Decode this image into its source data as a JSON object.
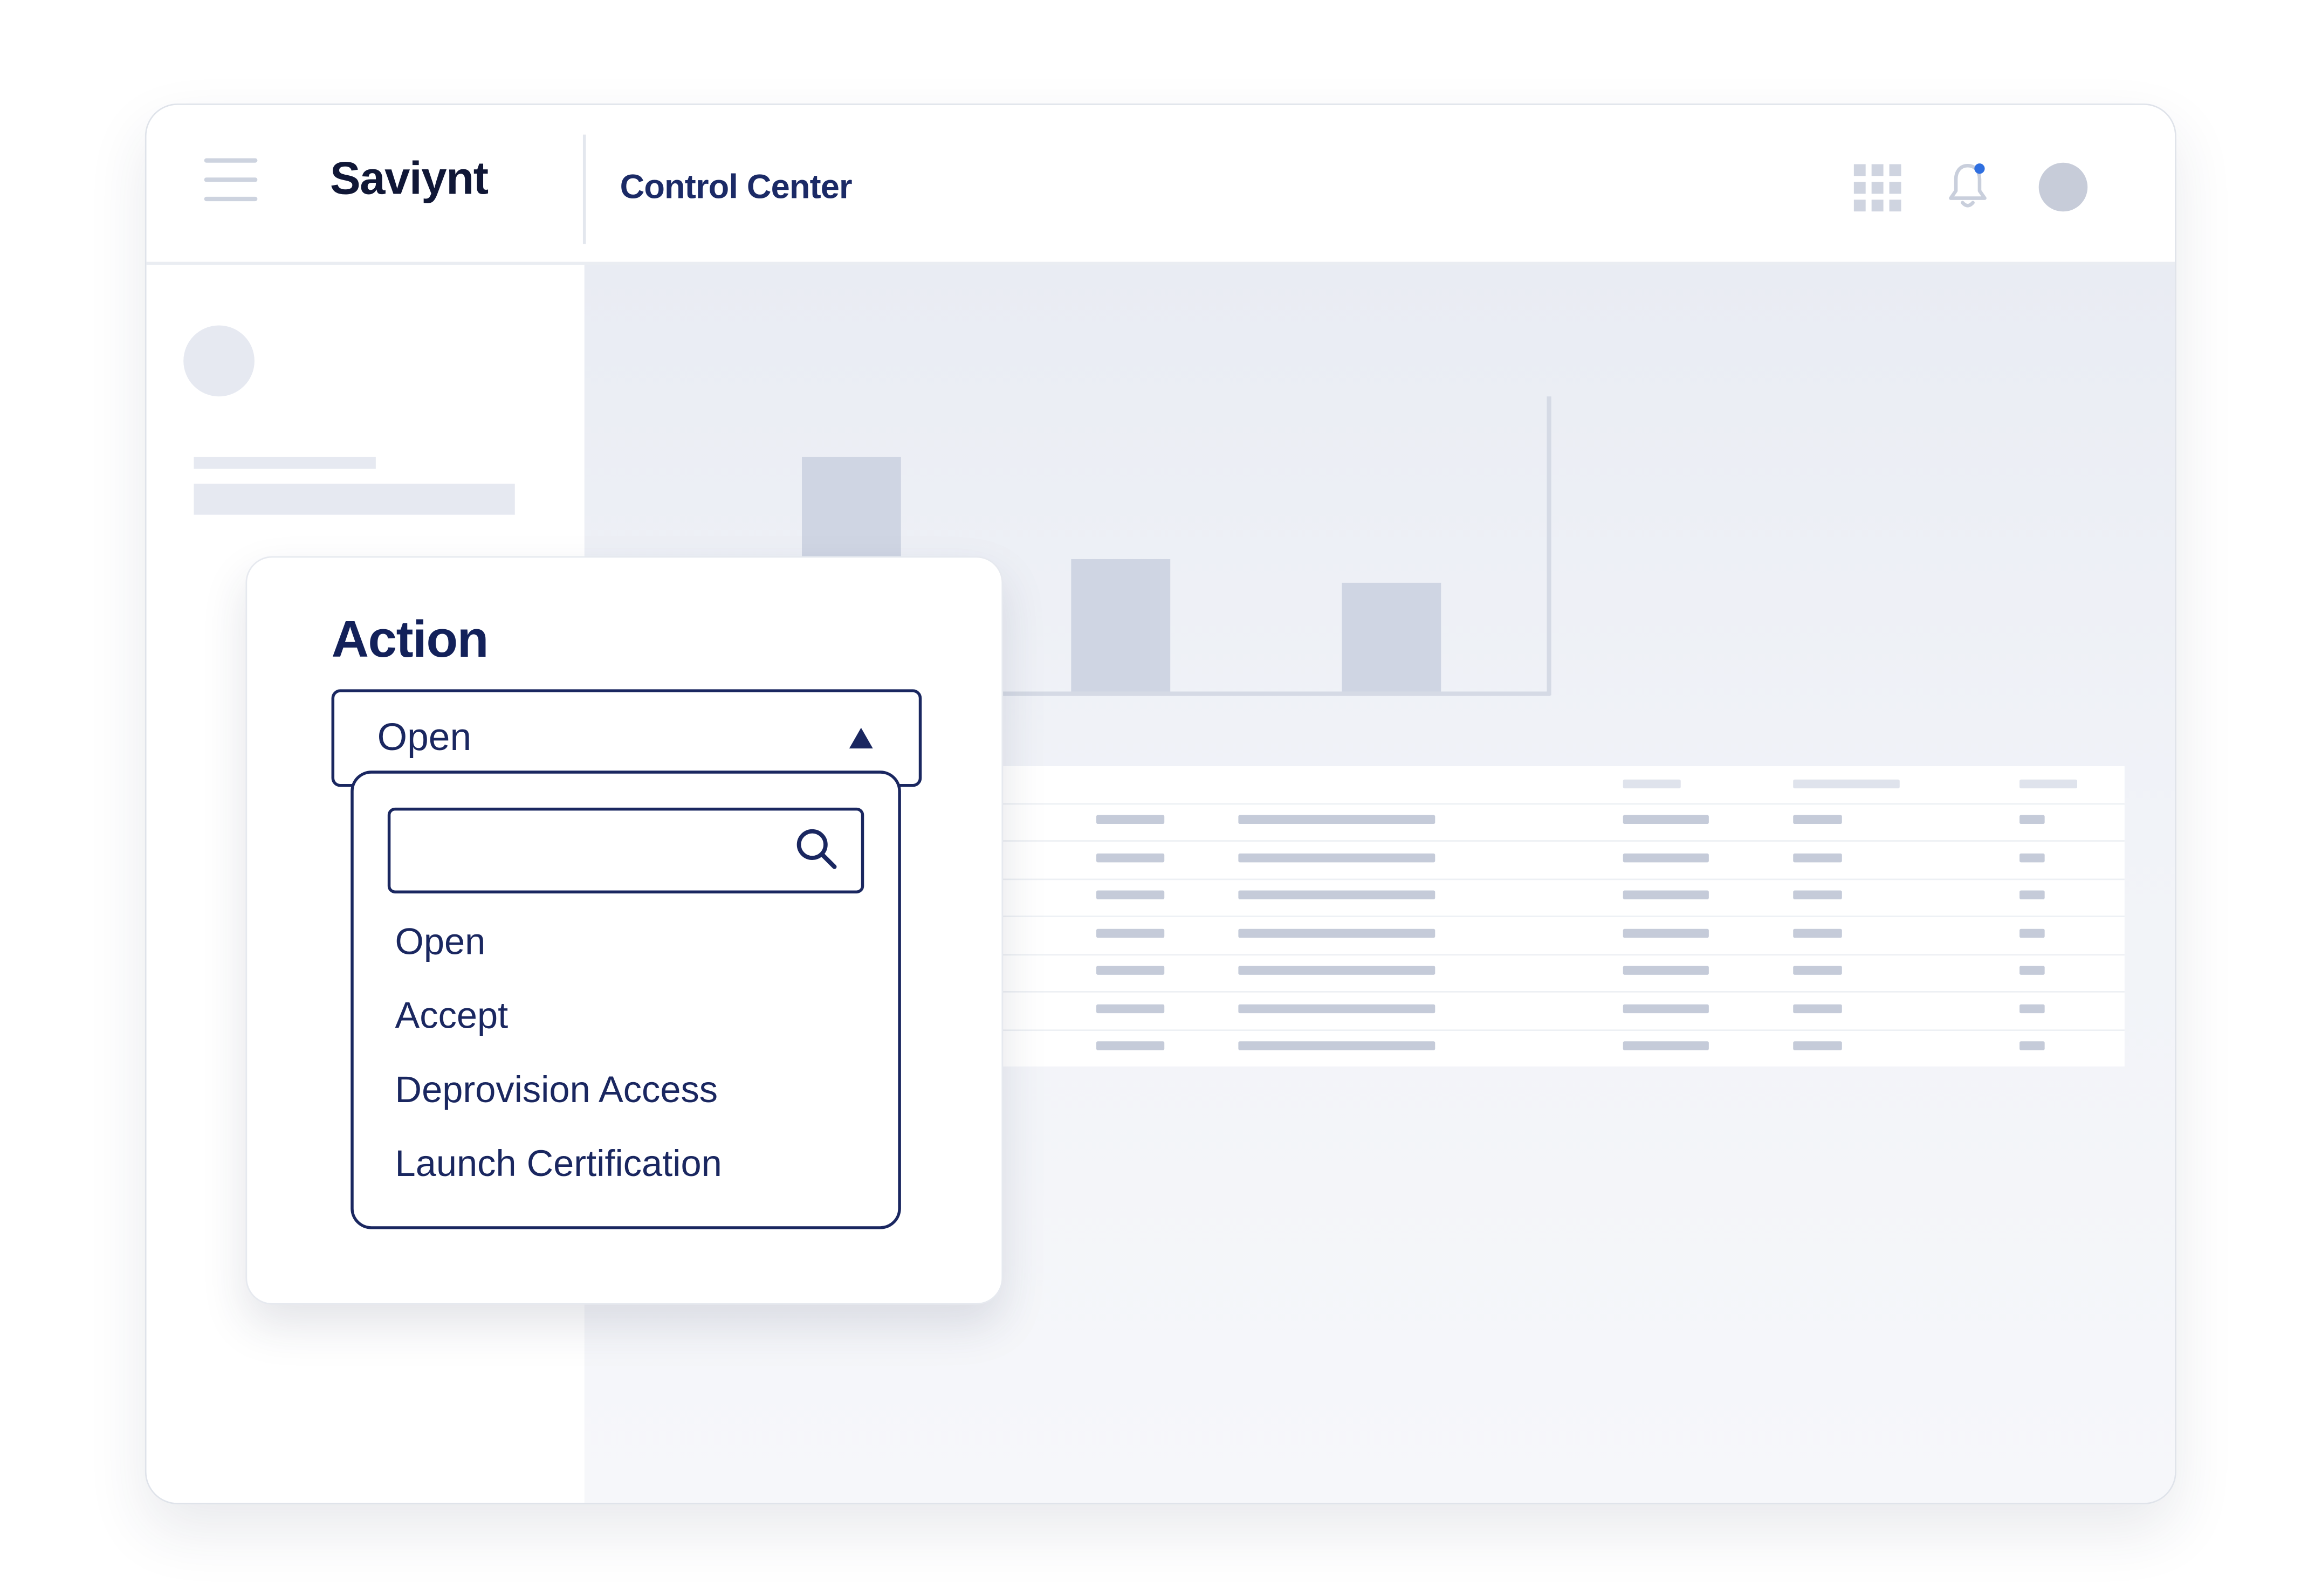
{
  "header": {
    "logo": "Saviynt",
    "app_title": "Control Center",
    "icons": [
      "menu-icon",
      "apps-grid-icon",
      "bell-icon",
      "avatar"
    ]
  },
  "action_panel": {
    "title": "Action",
    "selected_value": "Open",
    "search_placeholder": "",
    "options": [
      "Open",
      "Accept",
      "Deprovision Access",
      "Launch Certification"
    ]
  },
  "colors": {
    "primary": "#1a2760",
    "placeholder": "#c5cbd9",
    "notification_dot": "#2f6fe0"
  }
}
